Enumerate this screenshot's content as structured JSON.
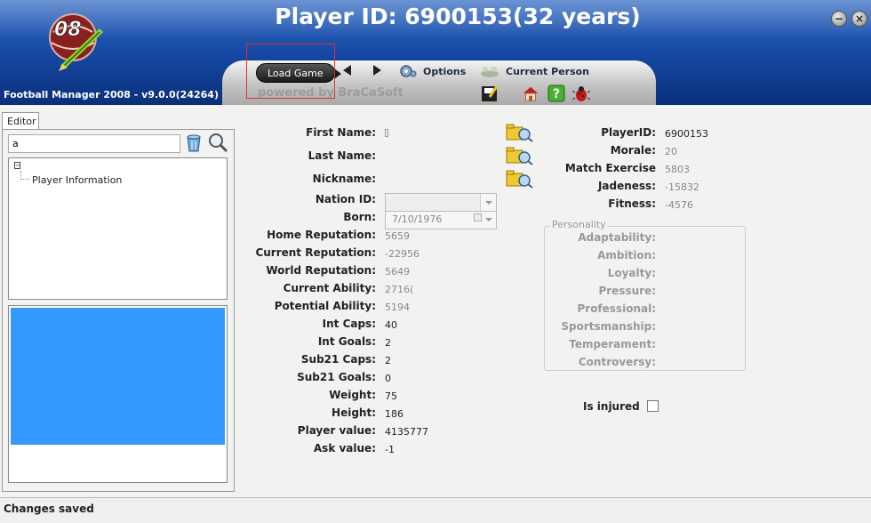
{
  "window": {
    "title": "Player ID: 6900153(32 years)",
    "app_version": "Football Manager 2008 - v9.0.0(24264)",
    "logo_text": "08"
  },
  "toolbar": {
    "load_game": "Load Game",
    "options": "Options",
    "current_person": "Current Person",
    "powered_by": "powered by BraCaSoft"
  },
  "sidebar": {
    "tab": "Editor",
    "search_value": "a",
    "tree_item": "Player Information"
  },
  "form": {
    "first_name_label": "First Name:",
    "last_name_label": "Last Name:",
    "nickname_label": "Nickname:",
    "nation_id_label": "Nation ID:",
    "born_label": "Born:",
    "born_value": "7/10/1976",
    "home_reputation_label": "Home Reputation:",
    "home_reputation": "5659",
    "current_reputation_label": "Current Reputation:",
    "current_reputation": "-22956",
    "world_reputation_label": "World Reputation:",
    "world_reputation": "5649",
    "current_ability_label": "Current Ability:",
    "current_ability": "2716(",
    "potential_ability_label": "Potential Ability:",
    "potential_ability": "5194",
    "int_caps_label": "Int Caps:",
    "int_caps": "40",
    "int_goals_label": "Int Goals:",
    "int_goals": "2",
    "sub21_caps_label": "Sub21 Caps:",
    "sub21_caps": "2",
    "sub21_goals_label": "Sub21 Goals:",
    "sub21_goals": "0",
    "weight_label": "Weight:",
    "weight": "75",
    "height_label": "Height:",
    "height": "186",
    "player_value_label": "Player value:",
    "player_value": "4135777",
    "ask_value_label": "Ask value:",
    "ask_value": "-1"
  },
  "stats": {
    "player_id_label": "PlayerID:",
    "player_id": "6900153",
    "morale_label": "Morale:",
    "morale": "20",
    "match_exercise_label": "Match Exercise",
    "match_exercise": "5803",
    "jadeness_label": "Jadeness:",
    "jadeness": "-15832",
    "fitness_label": "Fitness:",
    "fitness": "-4576"
  },
  "personality": {
    "legend": "Personality",
    "adaptability": "Adaptability:",
    "ambition": "Ambition:",
    "loyalty": "Loyalty:",
    "pressure": "Pressure:",
    "professional": "Professional:",
    "sportsmanship": "Sportsmanship:",
    "temperament": "Temperament:",
    "controversy": "Controversy:"
  },
  "injury": {
    "label": "Is injured",
    "checked": false
  },
  "status": {
    "text": "Changes saved"
  },
  "colors": {
    "header_blue": "#174ca8",
    "selection_blue": "#3399ff"
  }
}
